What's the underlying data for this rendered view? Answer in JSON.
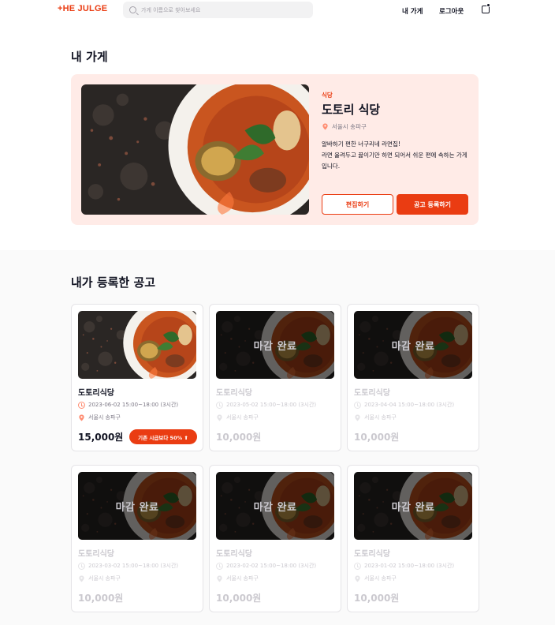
{
  "header": {
    "logo": "+HE JULGE",
    "search_placeholder": "가게 이름으로 찾아보세요",
    "nav": {
      "my_store": "내 가게",
      "logout": "로그아웃"
    }
  },
  "store_section": {
    "title": "내 가게",
    "category": "식당",
    "name": "도토리 식당",
    "address": "서울시 송파구",
    "description": "알바하기 편한 너구리네 라면집!\n라면 올려두고 끓이기만 하면 되어서 쉬운 편에 속하는 가게입니다.",
    "edit_label": "편집하기",
    "post_label": "공고 등록하기"
  },
  "posts_section": {
    "title": "내가 등록한 공고",
    "closed_label": "마감 완료",
    "posts": [
      {
        "name": "도토리식당",
        "time": "2023-06-02 15:00~18:00 (3시간)",
        "address": "서울시 송파구",
        "wage": "15,000원",
        "badge": "기존 시급보다 50% ⬆",
        "closed": false
      },
      {
        "name": "도토리식당",
        "time": "2023-05-02 15:00~18:00 (3시간)",
        "address": "서울시 송파구",
        "wage": "10,000원",
        "closed": true
      },
      {
        "name": "도토리식당",
        "time": "2023-04-04 15:00~18:00 (3시간)",
        "address": "서울시 송파구",
        "wage": "10,000원",
        "closed": true
      },
      {
        "name": "도토리식당",
        "time": "2023-03-02 15:00~18:00 (3시간)",
        "address": "서울시 송파구",
        "wage": "10,000원",
        "closed": true
      },
      {
        "name": "도토리식당",
        "time": "2023-02-02 15:00~18:00 (3시간)",
        "address": "서울시 송파구",
        "wage": "10,000원",
        "closed": true
      },
      {
        "name": "도토리식당",
        "time": "2023-01-02 15:00~18:00 (3시간)",
        "address": "서울시 송파구",
        "wage": "10,000원",
        "closed": true
      }
    ]
  },
  "colors": {
    "accent": "#ea3c12",
    "store_card_bg": "#ffebe7",
    "muted": "#cbc9cf"
  }
}
